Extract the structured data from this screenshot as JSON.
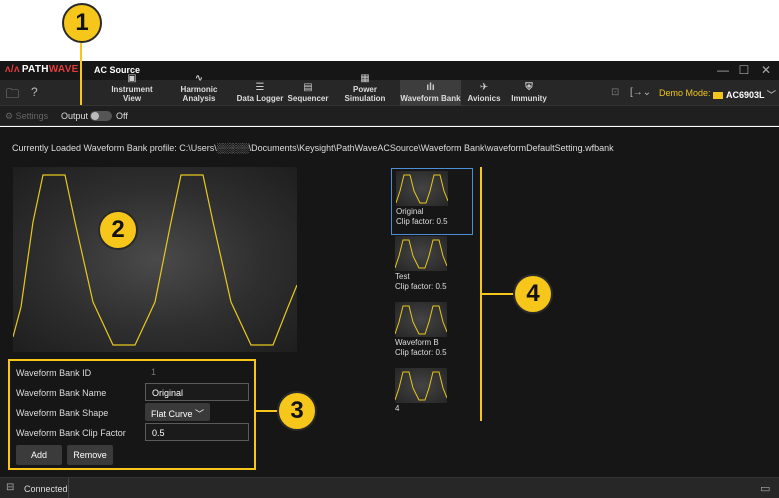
{
  "window": {
    "app_title": "AC Source",
    "logo_text_1": "PATH",
    "logo_text_2": "WAVE",
    "minimize": "—",
    "maximize": "☐",
    "close": "✕"
  },
  "toolbar": {
    "tabs": [
      {
        "label": "Instrument View",
        "icon": "instrument-view-icon",
        "glyph": "▣"
      },
      {
        "label": "Harmonic Analysis",
        "icon": "harmonic-analysis-icon",
        "glyph": "∿"
      },
      {
        "label": "Data Logger",
        "icon": "data-logger-icon",
        "glyph": "☰"
      },
      {
        "label": "Sequencer",
        "icon": "sequencer-icon",
        "glyph": "▤"
      },
      {
        "label": "Power Simulation",
        "icon": "power-simulation-icon",
        "glyph": "▦"
      },
      {
        "label": "Waveform Bank",
        "icon": "waveform-bank-icon",
        "glyph": "ılı"
      },
      {
        "label": "Avionics",
        "icon": "avionics-icon",
        "glyph": "✈"
      },
      {
        "label": "Immunity",
        "icon": "immunity-icon",
        "glyph": "⛨"
      }
    ],
    "active_tab": "Waveform Bank",
    "demo_mode_label": "Demo Mode:",
    "device_name": "AC6903L"
  },
  "settings_bar": {
    "settings_label": "Settings",
    "output_label": "Output",
    "output_state": "Off"
  },
  "profile": {
    "path_text": "Currently Loaded Waveform Bank profile: C:\\Users\\░░░░░\\Documents\\Keysight\\PathWaveACSource\\Waveform Bank\\waveformDefaultSetting.wfbank"
  },
  "properties": {
    "id_label": "Waveform Bank ID",
    "id_value": "1",
    "name_label": "Waveform Bank Name",
    "name_value": "Original",
    "shape_label": "Waveform Bank Shape",
    "shape_value": "Flat Curve",
    "clip_label": "Waveform Bank Clip Factor",
    "clip_value": "0.5",
    "add_label": "Add",
    "remove_label": "Remove"
  },
  "bank_list": [
    {
      "name": "Original",
      "clip": "Clip factor: 0.5",
      "selected": true
    },
    {
      "name": "Test",
      "clip": "Clip factor: 0.5",
      "selected": false
    },
    {
      "name": "Waveform B",
      "clip": "Clip factor: 0.5",
      "selected": false
    },
    {
      "name": "4",
      "clip": "",
      "selected": false
    }
  ],
  "callouts": [
    "1",
    "2",
    "3",
    "4"
  ],
  "status": {
    "text": "Connected"
  },
  "colors": {
    "waveform": "#e8c81e",
    "callout": "#f6c61a",
    "selection": "#4d8fd6",
    "demo_mode": "#f2c51e"
  }
}
